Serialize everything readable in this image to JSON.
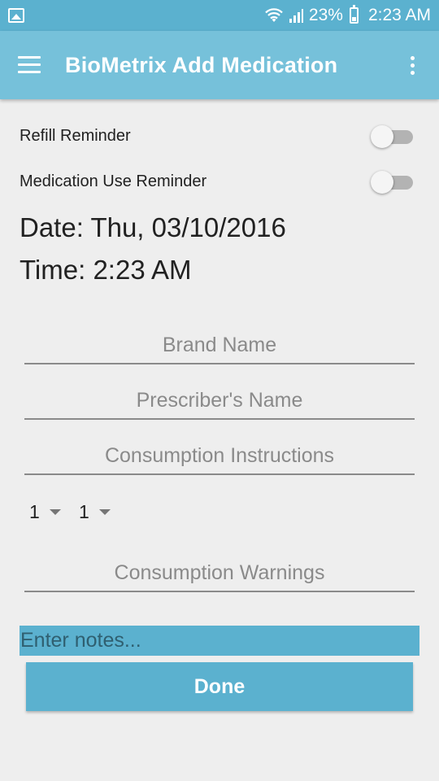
{
  "status_bar": {
    "battery": "23%",
    "time": "2:23 AM"
  },
  "app_bar": {
    "title": "BioMetrix Add Medication"
  },
  "reminders": [
    {
      "label": "Refill Reminder",
      "on": false
    },
    {
      "label": "Medication Use Reminder",
      "on": false
    }
  ],
  "date_text": "Date: Thu, 03/10/2016",
  "time_text": "Time: 2:23 AM",
  "fields": {
    "brand_name": "Brand Name",
    "prescriber_name": "Prescriber's Name",
    "consumption_instructions": "Consumption Instructions",
    "consumption_warnings": "Consumption Warnings"
  },
  "spinners": [
    "1",
    "1"
  ],
  "notes_placeholder": "Enter notes...",
  "done_label": "Done",
  "colors": {
    "status_bar": "#5bb1cf",
    "app_bar": "#76c1da",
    "accent": "#5bb1cf",
    "background": "#eeeeee"
  }
}
